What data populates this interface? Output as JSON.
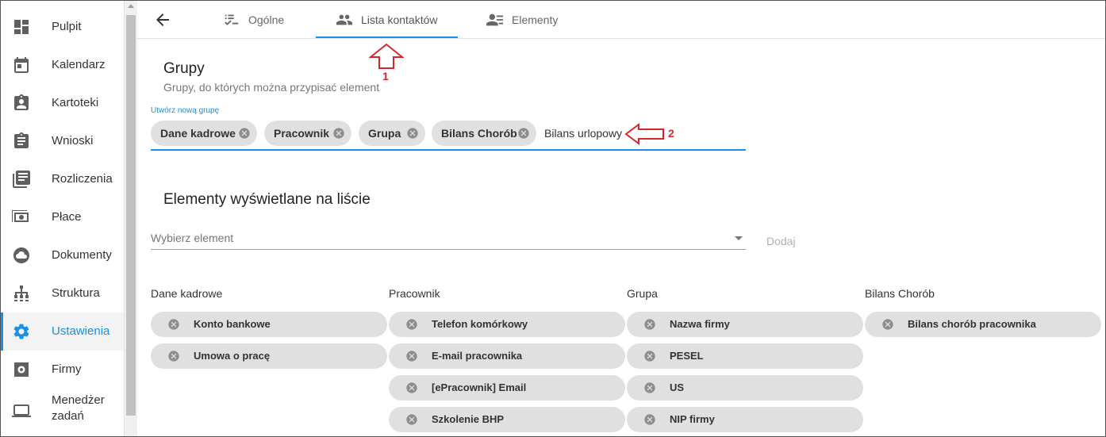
{
  "sidebar": {
    "items": [
      {
        "label": "Pulpit",
        "icon": "dashboard-icon"
      },
      {
        "label": "Kalendarz",
        "icon": "calendar-icon"
      },
      {
        "label": "Kartoteki",
        "icon": "badge-icon"
      },
      {
        "label": "Wnioski",
        "icon": "clipboard-icon"
      },
      {
        "label": "Rozliczenia",
        "icon": "document-list-icon"
      },
      {
        "label": "Płace",
        "icon": "money-icon"
      },
      {
        "label": "Dokumenty",
        "icon": "cloud-icon"
      },
      {
        "label": "Struktura",
        "icon": "hierarchy-icon"
      },
      {
        "label": "Ustawienia",
        "icon": "gear-icon",
        "active": true
      },
      {
        "label": "Firmy",
        "icon": "company-settings-icon"
      },
      {
        "label": "Menedżer zadań",
        "label_line1": "Menedżer",
        "label_line2": "zadań",
        "icon": "laptop-icon"
      }
    ]
  },
  "tabs": [
    {
      "label": "Ogólne",
      "icon": "checklist-icon"
    },
    {
      "label": "Lista kontaktów",
      "icon": "people-icon",
      "active": true
    },
    {
      "label": "Elementy",
      "icon": "person-list-icon"
    }
  ],
  "groups": {
    "title": "Grupy",
    "subtitle": "Grupy, do których można przypisać element",
    "field_label": "Utwórz nową grupę",
    "chips": [
      "Dane kadrowe",
      "Pracownik",
      "Grupa",
      "Bilans Chorób"
    ],
    "typed_value": "Bilans urlopowy"
  },
  "elements": {
    "title": "Elementy wyświetlane na liście",
    "select_placeholder": "Wybierz element",
    "add_label": "Dodaj",
    "columns": [
      {
        "title": "Dane kadrowe",
        "items": [
          "Konto bankowe",
          "Umowa o pracę"
        ]
      },
      {
        "title": "Pracownik",
        "items": [
          "Telefon komórkowy",
          "E-mail pracownika",
          "[ePracownik] Email",
          "Szkolenie BHP"
        ]
      },
      {
        "title": "Grupa",
        "items": [
          "Nazwa firmy",
          "PESEL",
          "US",
          "NIP firmy"
        ]
      },
      {
        "title": "Bilans Chorób",
        "items": [
          "Bilans chorób pracownika"
        ]
      }
    ]
  },
  "annotations": {
    "arrow1": "1",
    "arrow2": "2",
    "color": "#d6262b"
  },
  "colors": {
    "accent": "#1a8fe3",
    "chip_bg": "#e0e0e0"
  }
}
